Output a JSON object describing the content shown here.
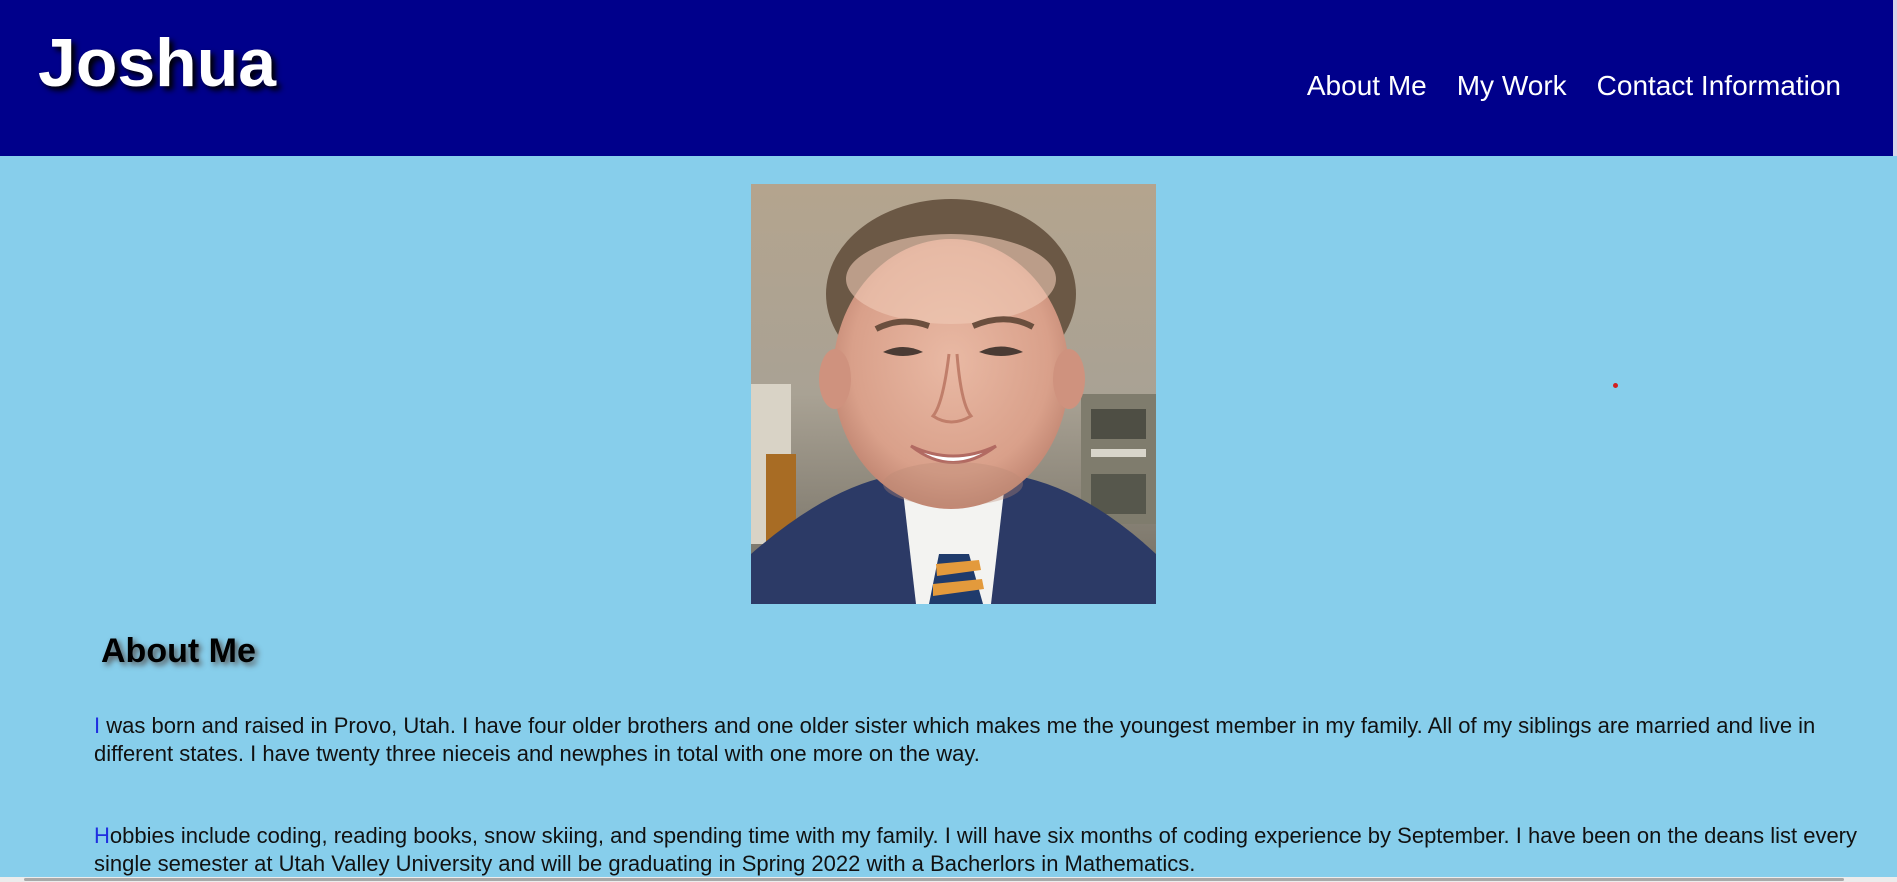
{
  "header": {
    "site_title": "Joshua",
    "nav": [
      {
        "label": "About Me"
      },
      {
        "label": "My Work"
      },
      {
        "label": "Contact Information"
      }
    ]
  },
  "main": {
    "section_heading": "About Me",
    "paragraphs": [
      {
        "first_letter": "I",
        "rest": " was born and raised in Provo, Utah. I have four older brothers and one older sister which makes me the youngest member in my family. All of my siblings are married and live in different states. I have twenty three nieceis and newphes in total with one more on the way."
      },
      {
        "first_letter": "H",
        "rest": "obbies include coding, reading books, snow skiing, and spending time with my family. I will have six months of coding experience by September. I have been on the deans list every single semester at Utah Valley University and will be graduating in Spring 2022 with a Bacherlors in Mathematics."
      }
    ]
  },
  "colors": {
    "header_bg": "#00008b",
    "page_bg": "#87ceeb",
    "first_letter": "#1f2ee0",
    "nav_text": "#ffffff"
  }
}
